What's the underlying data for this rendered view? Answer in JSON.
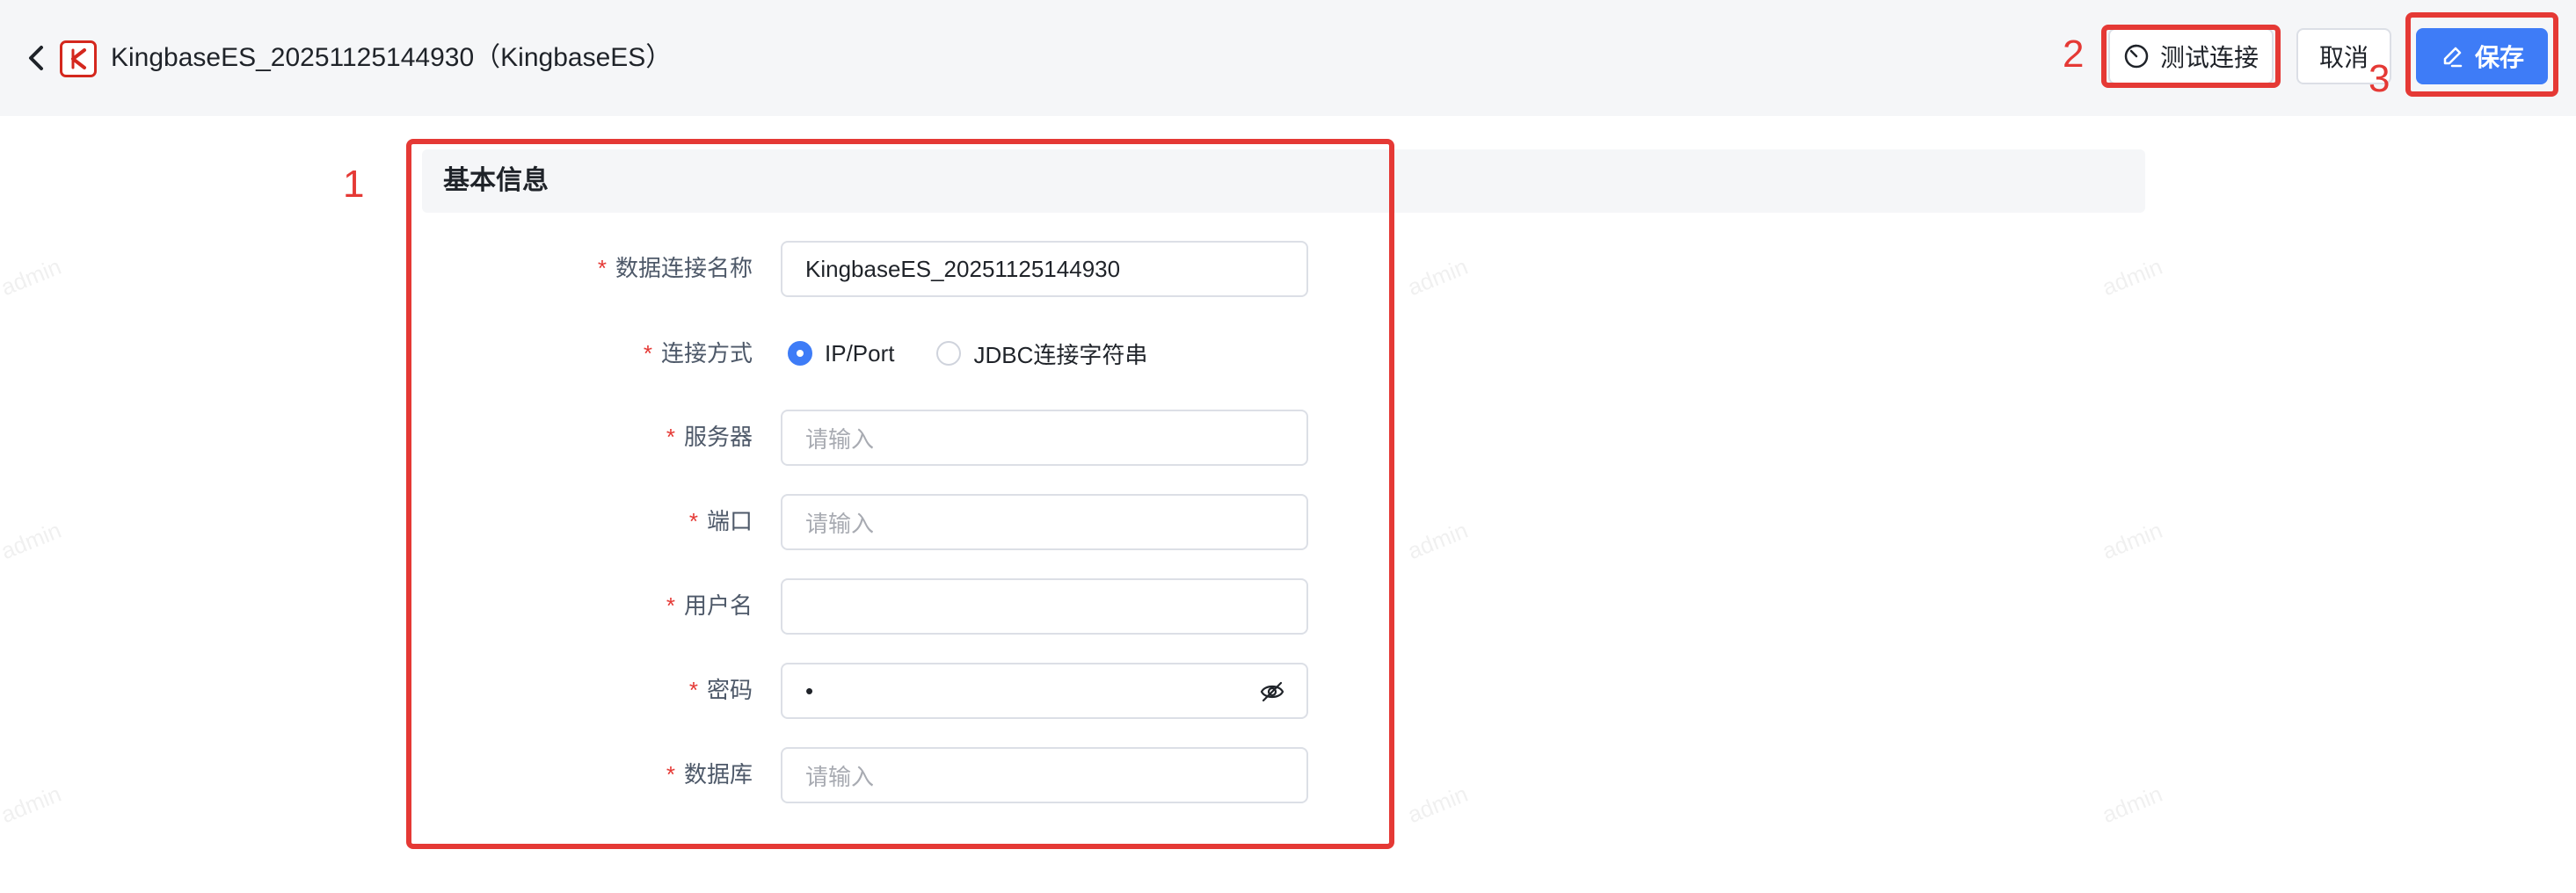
{
  "header": {
    "title": "KingbaseES_20251125144930（KingbaseES）",
    "test_label": "测试连接",
    "cancel_label": "取消",
    "save_label": "保存"
  },
  "annotations": {
    "one": "1",
    "two": "2",
    "three": "3"
  },
  "section": {
    "title": "基本信息"
  },
  "form": {
    "required_mark": "*",
    "name_label": "数据连接名称",
    "name_value": "KingbaseES_20251125144930",
    "mode_label": "连接方式",
    "mode_options": [
      "IP/Port",
      "JDBC连接字符串"
    ],
    "mode_selected": "IP/Port",
    "server_label": "服务器",
    "server_placeholder": "请输入",
    "port_label": "端口",
    "port_placeholder": "请输入",
    "user_label": "用户名",
    "user_value": "",
    "password_label": "密码",
    "password_mask": "•",
    "db_label": "数据库",
    "db_placeholder": "请输入"
  },
  "watermark": "admin",
  "colors": {
    "accent": "#3e7cf7",
    "annotation": "#e53935",
    "brand": "#d4281e"
  },
  "icons": [
    "chevron-left-icon",
    "kingbase-logo-icon",
    "test-connection-icon",
    "edit-icon",
    "eye-off-icon"
  ]
}
